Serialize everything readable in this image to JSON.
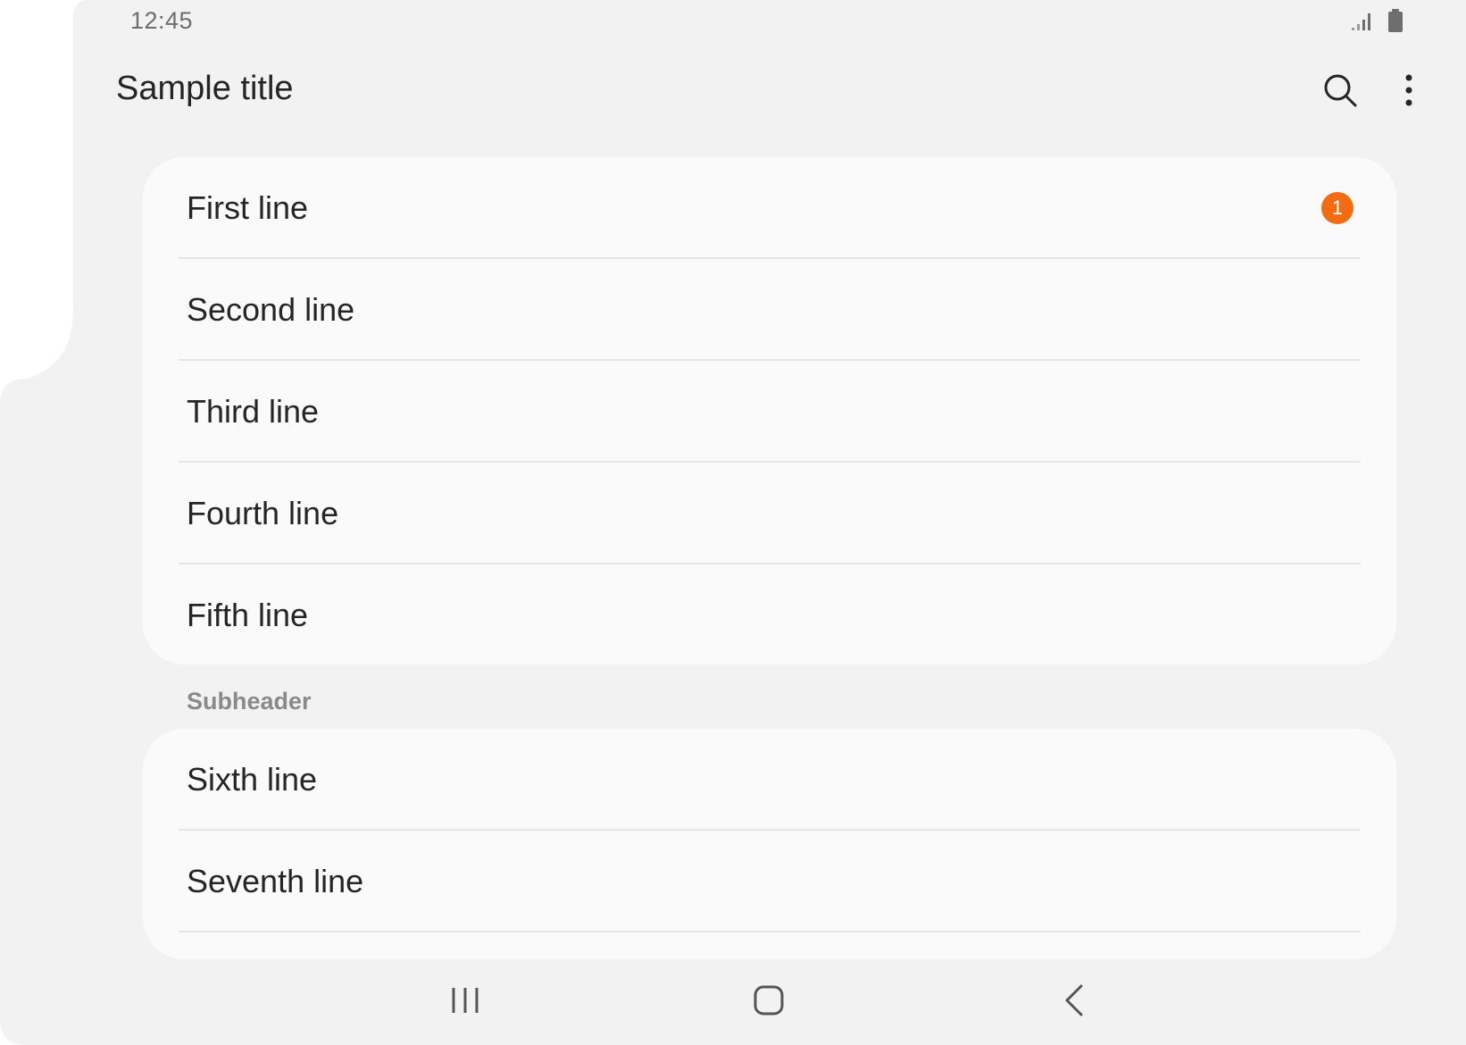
{
  "status_bar": {
    "time": "12:45",
    "icons": [
      "signal-icon",
      "battery-icon"
    ]
  },
  "app_bar": {
    "title": "Sample title",
    "actions": [
      "search-icon",
      "more-vert-icon"
    ]
  },
  "list_group_1": {
    "items": [
      {
        "label": "First line",
        "badge": "1"
      },
      {
        "label": "Second line"
      },
      {
        "label": "Third line"
      },
      {
        "label": "Fourth line"
      },
      {
        "label": "Fifth line"
      }
    ]
  },
  "subheader": "Subheader",
  "list_group_2": {
    "items": [
      {
        "label": "Sixth line"
      },
      {
        "label": "Seventh line"
      }
    ]
  },
  "nav_bar": {
    "buttons": [
      "recents-icon",
      "home-icon",
      "back-icon"
    ]
  },
  "colors": {
    "background": "#f2f2f2",
    "card": "#fafafa",
    "accent_badge": "#f56b12",
    "text_primary": "#252525",
    "text_secondary": "#8a8a8a"
  }
}
